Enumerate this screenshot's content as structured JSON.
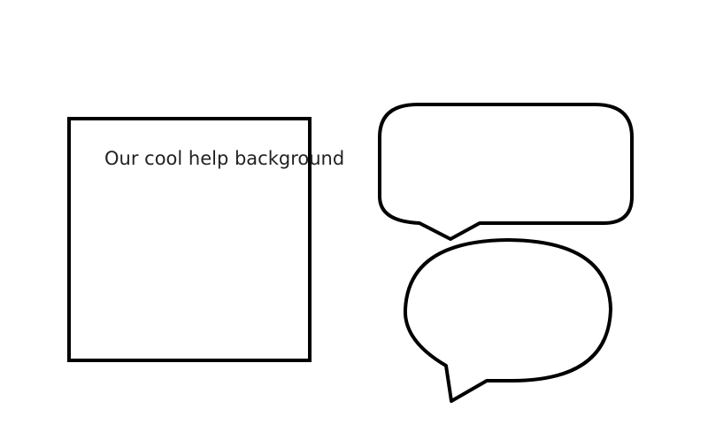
{
  "help_label": "Our cool help background",
  "colors": {
    "stroke": "#000000",
    "background": "#ffffff",
    "text": "#222222"
  },
  "shapes": [
    {
      "name": "square-box",
      "kind": "square"
    },
    {
      "name": "rounded-rectangle-speech-bubble",
      "kind": "rounded-callout"
    },
    {
      "name": "oval-speech-bubble",
      "kind": "oval-callout"
    }
  ]
}
